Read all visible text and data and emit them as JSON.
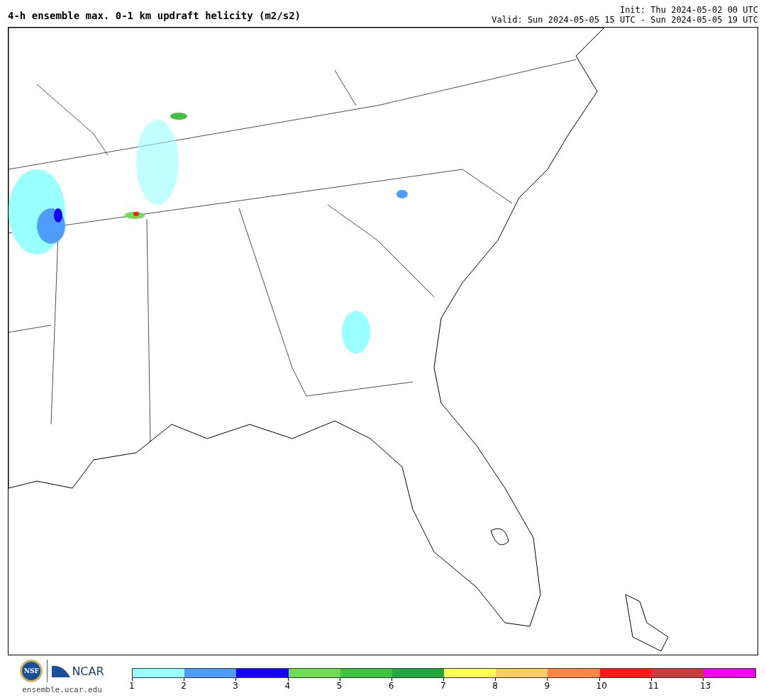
{
  "title": "4-h ensemble max. 0-1 km updraft helicity (m2/s2)",
  "init": "Init: Thu 2024-05-02 00 UTC",
  "valid": "Valid: Sun 2024-05-05 15 UTC - Sun 2024-05-05 19 UTC",
  "logos": {
    "nsf": "NSF",
    "ncar": "NCAR",
    "url": "ensemble.ucar.edu"
  },
  "legend": {
    "segments": [
      {
        "color": "#99ffff"
      },
      {
        "color": "#4f9cff"
      },
      {
        "color": "#1a00ff"
      },
      {
        "color": "#6fdc52"
      },
      {
        "color": "#3fc43f"
      },
      {
        "color": "#22a83a"
      },
      {
        "color": "#ffff55"
      },
      {
        "color": "#ffcc66"
      },
      {
        "color": "#ff8844"
      },
      {
        "color": "#ff1a1a"
      },
      {
        "color": "#c83c3c"
      },
      {
        "color": "#ee00ee"
      }
    ],
    "ticks": [
      "1",
      "2",
      "3",
      "4",
      "5",
      "6",
      "7",
      "8",
      "9",
      "10",
      "11",
      "13"
    ]
  }
}
